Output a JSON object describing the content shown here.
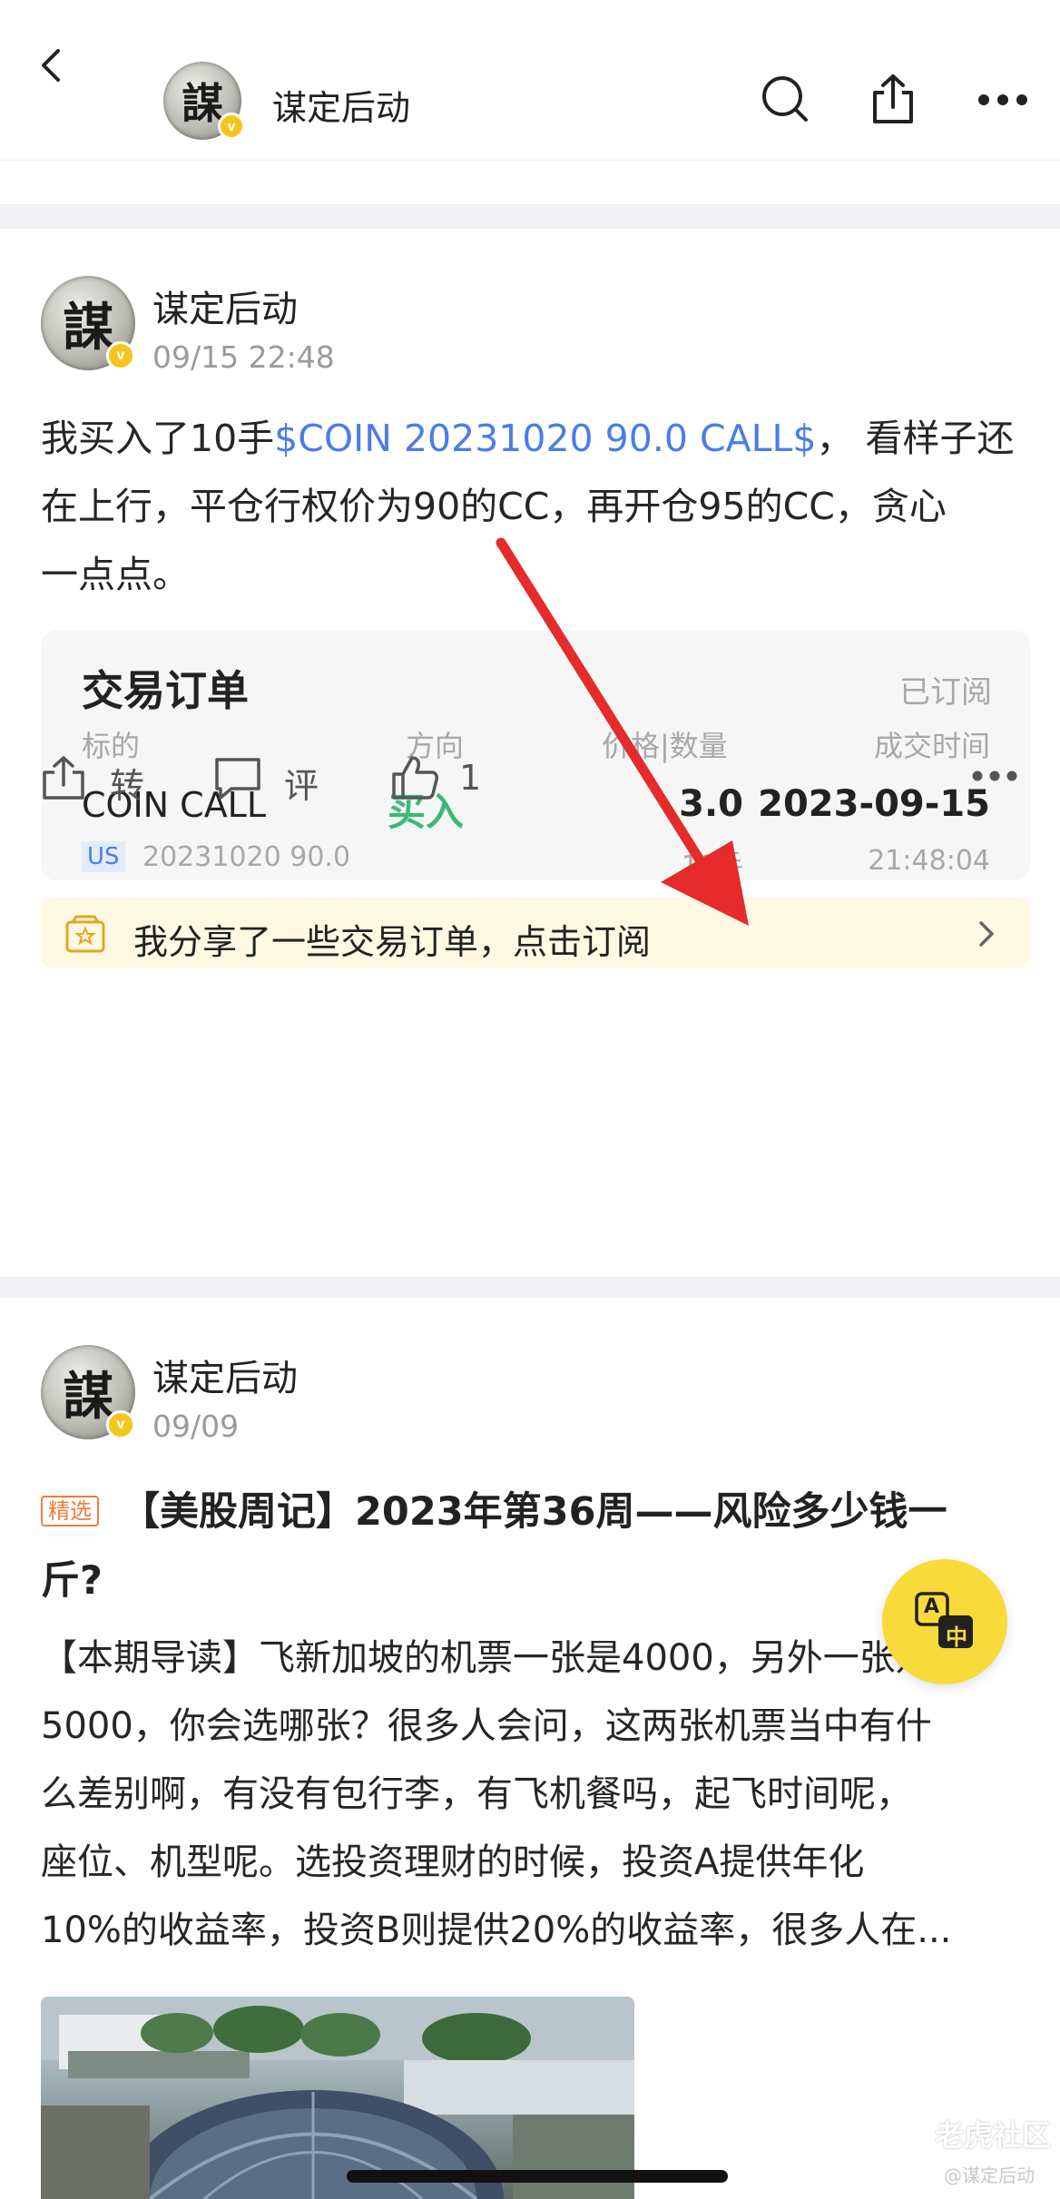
{
  "header": {
    "title": "谋定后动"
  },
  "post1": {
    "author": "谋定后动",
    "time": "09/15 22:48",
    "text_before": "我买入了10手",
    "link": "$COIN 20231020 90.0 CALL$",
    "text_line1_after": "， 看样子还",
    "text_line2": "在上行，平仓行权价为90的CC，再开仓95的CC，贪心",
    "text_line3": "一点点。",
    "order": {
      "title": "交易订单",
      "status": "已订阅",
      "headers": [
        "标的",
        "方向",
        "价格|数量",
        "成交时间"
      ],
      "symbol": "COIN CALL",
      "market": "US",
      "contract": "20231020 90.0",
      "direction": "买入",
      "price": "3.0",
      "qty": "10手",
      "date": "2023-09-15",
      "clock": "21:48:04"
    },
    "subscribe_text": "我分享了一些交易订单，点击订阅",
    "actions": {
      "repost": "转",
      "comment": "评",
      "like": "1"
    }
  },
  "post2": {
    "author": "谋定后动",
    "time": "09/09",
    "badge": "精选",
    "title_line1": "【美股周记】2023年第36周——风险多少钱一",
    "title_line2": "斤?",
    "lines": [
      "【本期导读】飞新加坡的机票一张是4000，另外一张是",
      "5000，你会选哪张？很多人会问，这两张机票当中有什",
      "么差别啊，有没有包行李，有飞机餐吗，起飞时间呢，",
      "座位、机型呢。选投资理财的时候，投资A提供年化",
      "10%的收益率，投资B则提供20%的收益率，很多人在..."
    ]
  },
  "translate": {
    "top": "A",
    "bottom": "中"
  },
  "watermark": {
    "brand": "老虎社区",
    "handle": "@谋定后动"
  },
  "avatar_char": "謀",
  "colors": {
    "accent": "#4a7de8",
    "buy": "#3cb878",
    "badge": "#f4c51e",
    "fab": "#f8da3b"
  }
}
